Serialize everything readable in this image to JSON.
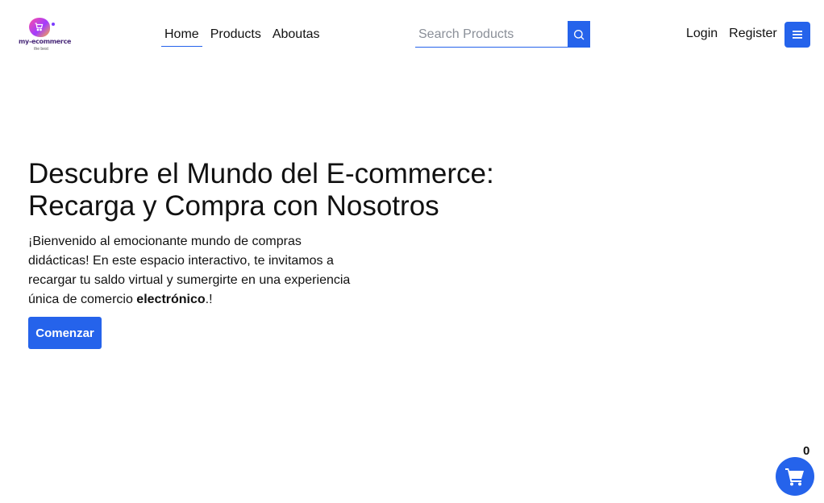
{
  "brand": {
    "logo_text": "my-ecommerce",
    "logo_sub": "the best",
    "colors": {
      "primary": "#2563eb",
      "logo_pink": "#ff4fa3",
      "logo_purple": "#a23bff"
    }
  },
  "nav": {
    "items": [
      {
        "label": "Home",
        "active": true
      },
      {
        "label": "Products",
        "active": false
      },
      {
        "label": "Aboutas",
        "active": false
      }
    ]
  },
  "search": {
    "placeholder": "Search Products",
    "value": "",
    "icon": "search-icon"
  },
  "auth": {
    "login": "Login",
    "register": "Register",
    "menu_icon": "menu-icon"
  },
  "hero": {
    "title_line1": "Descubre el Mundo del E-commerce:",
    "title_line2": "Recarga y Compra con Nosotros",
    "text_main": "¡Bienvenido al emocionante mundo de compras didácticas! En este espacio interactivo, te invitamos a recargar tu saldo virtual y sumergirte en una experiencia única de comercio ",
    "text_bold": "electrónico",
    "text_end": ".!",
    "cta_label": "Comenzar"
  },
  "cart": {
    "count": "0",
    "icon": "cart-icon"
  }
}
